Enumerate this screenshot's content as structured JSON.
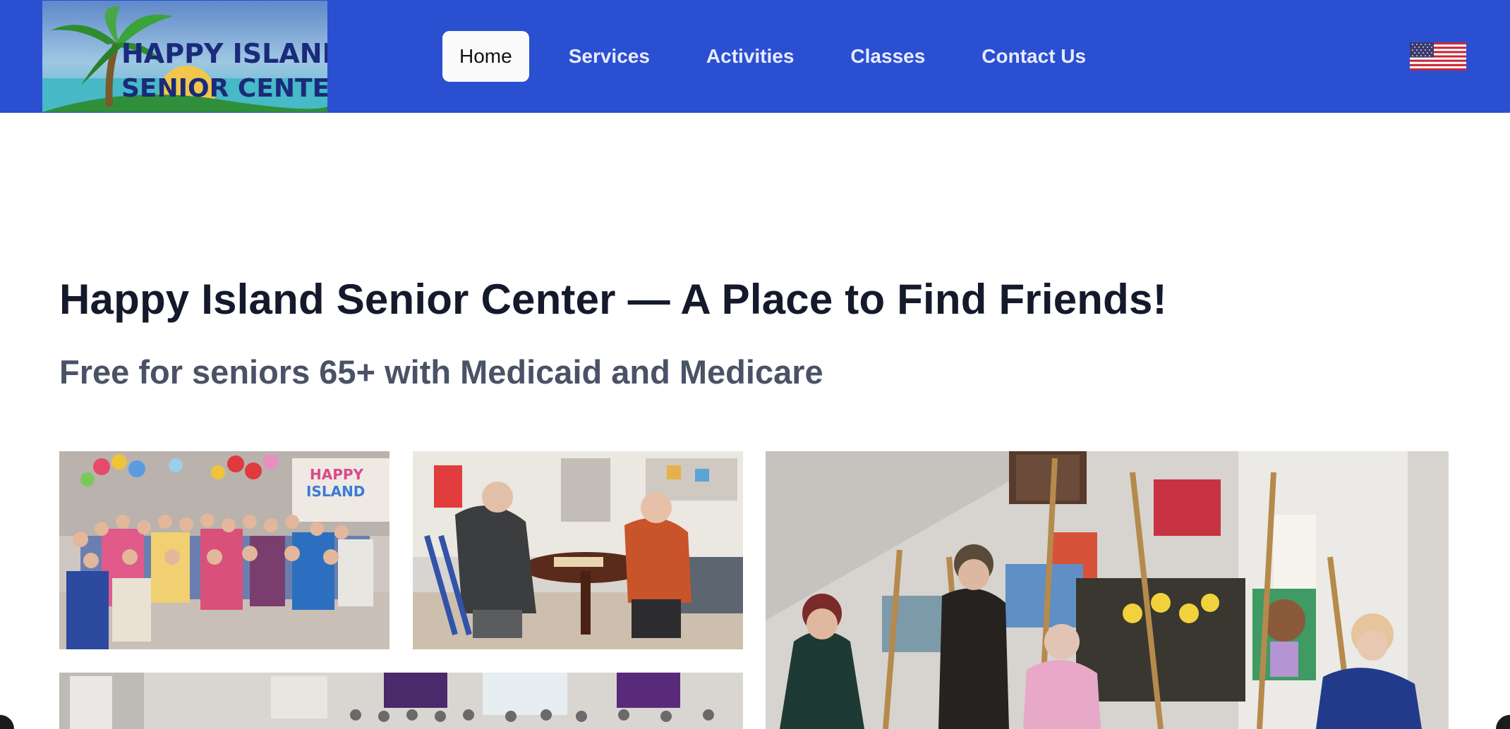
{
  "header": {
    "logo": {
      "line1": "HAPPY ISLAND",
      "line2": "SENIOR CENTER",
      "icon": "palm-tree-logo"
    },
    "nav": [
      {
        "label": "Home",
        "active": true
      },
      {
        "label": "Services",
        "active": false
      },
      {
        "label": "Activities",
        "active": false
      },
      {
        "label": "Classes",
        "active": false
      },
      {
        "label": "Contact Us",
        "active": false
      }
    ],
    "language_icon": "us-flag-icon",
    "colors": {
      "bar": "#2b4fd1",
      "active_tab": "#fafafa"
    }
  },
  "hero": {
    "title": "Happy Island Senior Center — A Place to Find Friends!",
    "subtitle": "Free for seniors 65+ with Medicaid and Medicare"
  },
  "gallery": {
    "photos": [
      {
        "name": "group-party-photo"
      },
      {
        "name": "chess-game-photo"
      },
      {
        "name": "painting-class-photo"
      },
      {
        "name": "dining-hall-photo"
      }
    ]
  }
}
